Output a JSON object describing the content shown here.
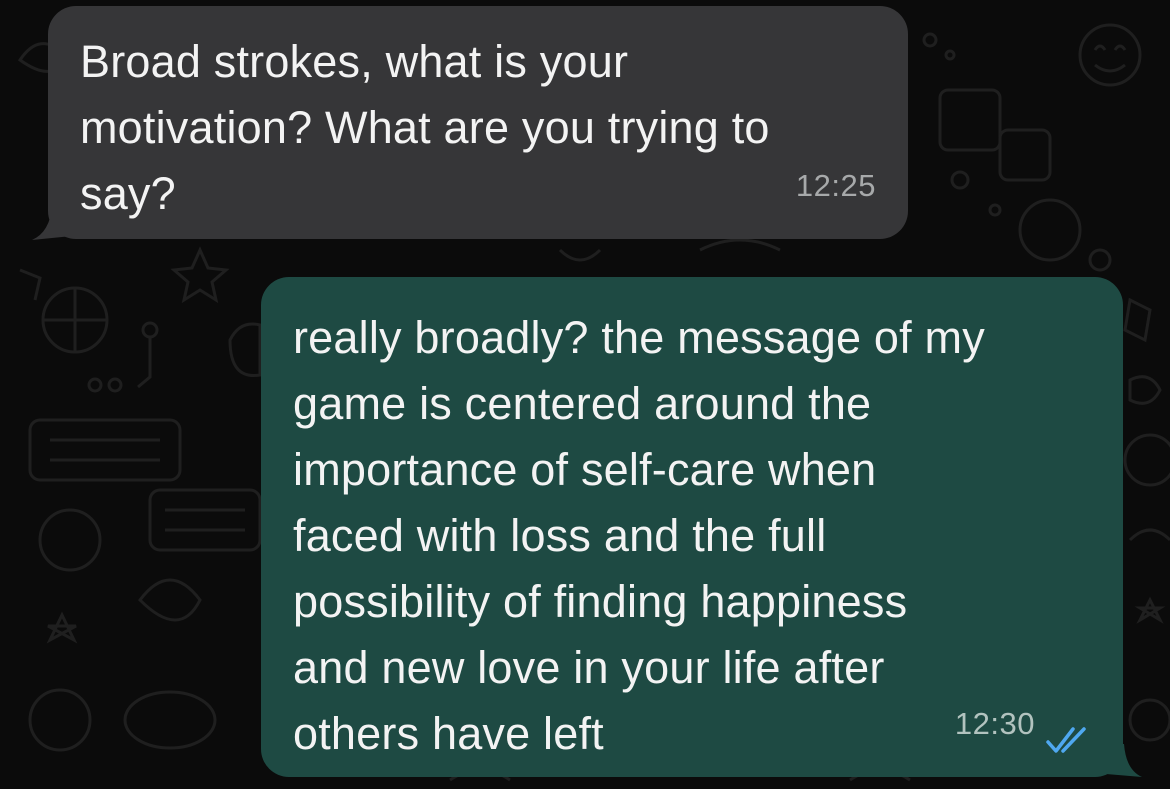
{
  "chat": {
    "messages": [
      {
        "direction": "incoming",
        "text": "Broad strokes, what is your\nmotivation? What are you trying to\nsay?",
        "time": "12:25"
      },
      {
        "direction": "outgoing",
        "text": "really broadly? the message of my\ngame is centered around the\nimportance of self-care when\nfaced with loss and the full\npossibility of finding happiness\nand new love in your life after\nothers have left",
        "time": "12:30",
        "status_icon": "double-check-read-icon"
      }
    ]
  },
  "colors": {
    "background": "#0b0b0b",
    "incoming_bubble": "#363638",
    "outgoing_bubble": "#1e4a43",
    "read_ticks": "#4fa8f0"
  }
}
